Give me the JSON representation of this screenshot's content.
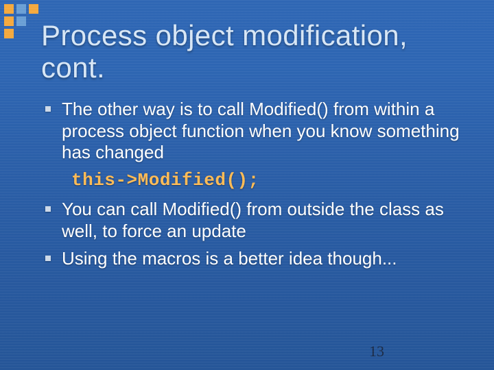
{
  "title": "Process object modification, cont.",
  "bullets": {
    "b1": "The other way is to call Modified() from within a process object function when you know something has changed",
    "code": "this->Modified();",
    "b2": "You can call Modified() from outside the class as well, to force an update",
    "b3": "Using the macros is a better idea though..."
  },
  "page_number": "13"
}
